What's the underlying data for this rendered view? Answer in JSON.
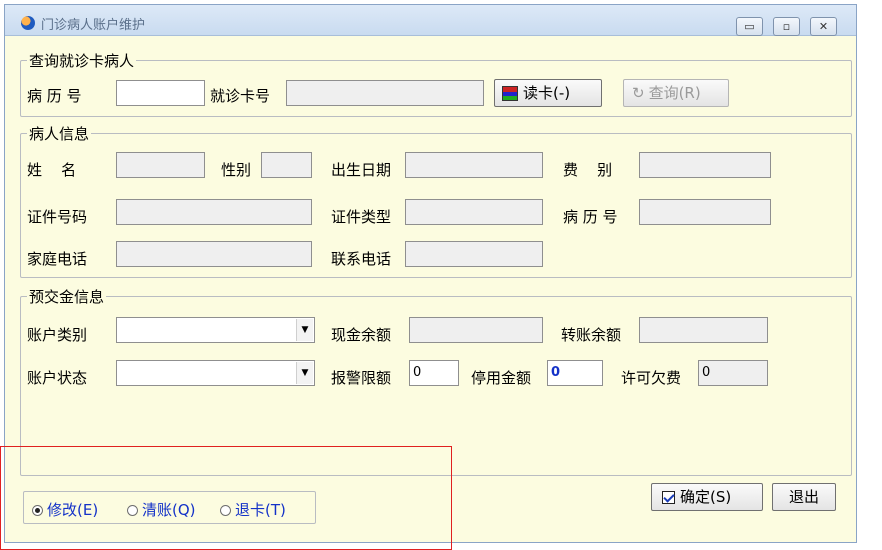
{
  "window": {
    "title": "门诊病人账户维护",
    "buttons": {
      "minimize": "▭",
      "maximize": "▫",
      "close": "✕"
    }
  },
  "query_group": {
    "title": "查询就诊卡病人",
    "record_no_label": "病 历 号",
    "record_no_value": "",
    "card_no_label": "就诊卡号",
    "card_no_value": "",
    "read_card_button": "读卡(-)",
    "query_button": "查询(R)"
  },
  "patient_group": {
    "title": "病人信息",
    "name_label": "姓    名",
    "gender_label": "性别",
    "birth_label": "出生日期",
    "fee_type_label": "费    别",
    "id_no_label": "证件号码",
    "id_type_label": "证件类型",
    "record_no_label": "病 历 号",
    "home_phone_label": "家庭电话",
    "contact_phone_label": "联系电话"
  },
  "deposit_group": {
    "title": "预交金信息",
    "account_type_label": "账户类别",
    "account_type_value": "",
    "cash_balance_label": "现金余额",
    "transfer_balance_label": "转账余额",
    "account_status_label": "账户状态",
    "account_status_value": "",
    "alarm_limit_label": "报警限额",
    "alarm_limit_value": "0",
    "stop_amount_label": "停用金额",
    "stop_amount_value": "0",
    "allowed_debt_label": "许可欠费",
    "allowed_debt_value": "0"
  },
  "mode_radios": [
    {
      "label": "修改(E)",
      "checked": true
    },
    {
      "label": "清账(Q)",
      "checked": false
    },
    {
      "label": "退卡(T)",
      "checked": false
    }
  ],
  "footer": {
    "confirm_button": "确定(S)",
    "exit_button": "退出"
  },
  "colors": {
    "window_bg": "#fcfce0",
    "radio_text": "#1432c8",
    "highlight": "#e02020"
  }
}
